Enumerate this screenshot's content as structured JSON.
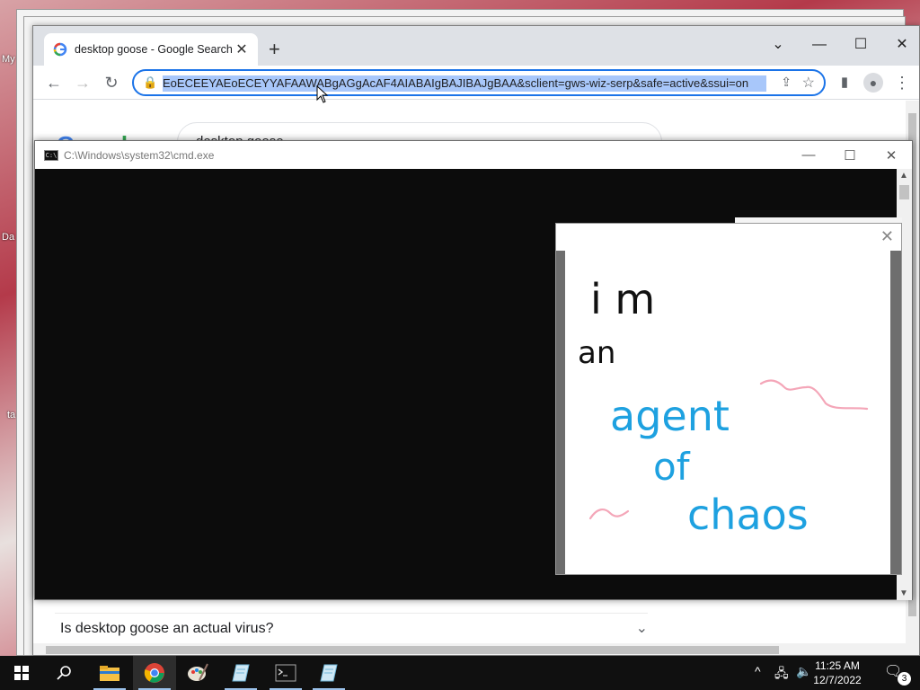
{
  "desktop": {
    "labels": [
      "My",
      "Da",
      "ta"
    ]
  },
  "chrome": {
    "tab_title": "desktop goose - Google Search",
    "tab_close": "✕",
    "new_tab": "+",
    "window_controls": {
      "dropdown": "⌄",
      "minimize": "—",
      "maximize": "☐",
      "close": "✕"
    },
    "url": "EoECEEYAEoECEYYAFAAWABgAGgAcAF4AIABAIgBAJIBAJgBAA&sclient=gws-wiz-serp&safe=active&ssui=on",
    "search_query": "desktop goose",
    "faq_question": "Is desktop goose an actual virus?",
    "logo": "Google"
  },
  "cmd": {
    "title": "C:\\Windows\\system32\\cmd.exe",
    "icon_text": "C:\\"
  },
  "note": {
    "lines": [
      "i m",
      "an",
      "agent",
      "of",
      "chaos"
    ],
    "colors": {
      "black_ink": "#111111",
      "blue_ink": "#1ea1e0",
      "pink_ink": "#f4a6b8"
    }
  },
  "taskbar": {
    "time": "11:25 AM",
    "date": "12/7/2022",
    "notification_count": "3",
    "apps": [
      "start-icon",
      "search-icon",
      "file-explorer-icon",
      "chrome-icon",
      "paint-icon",
      "notepad-icon",
      "cmd-icon",
      "notepad-icon"
    ]
  },
  "colors": {
    "accent": "#1a73e8",
    "selection": "#a8c7fa",
    "taskbar": "#101010"
  }
}
